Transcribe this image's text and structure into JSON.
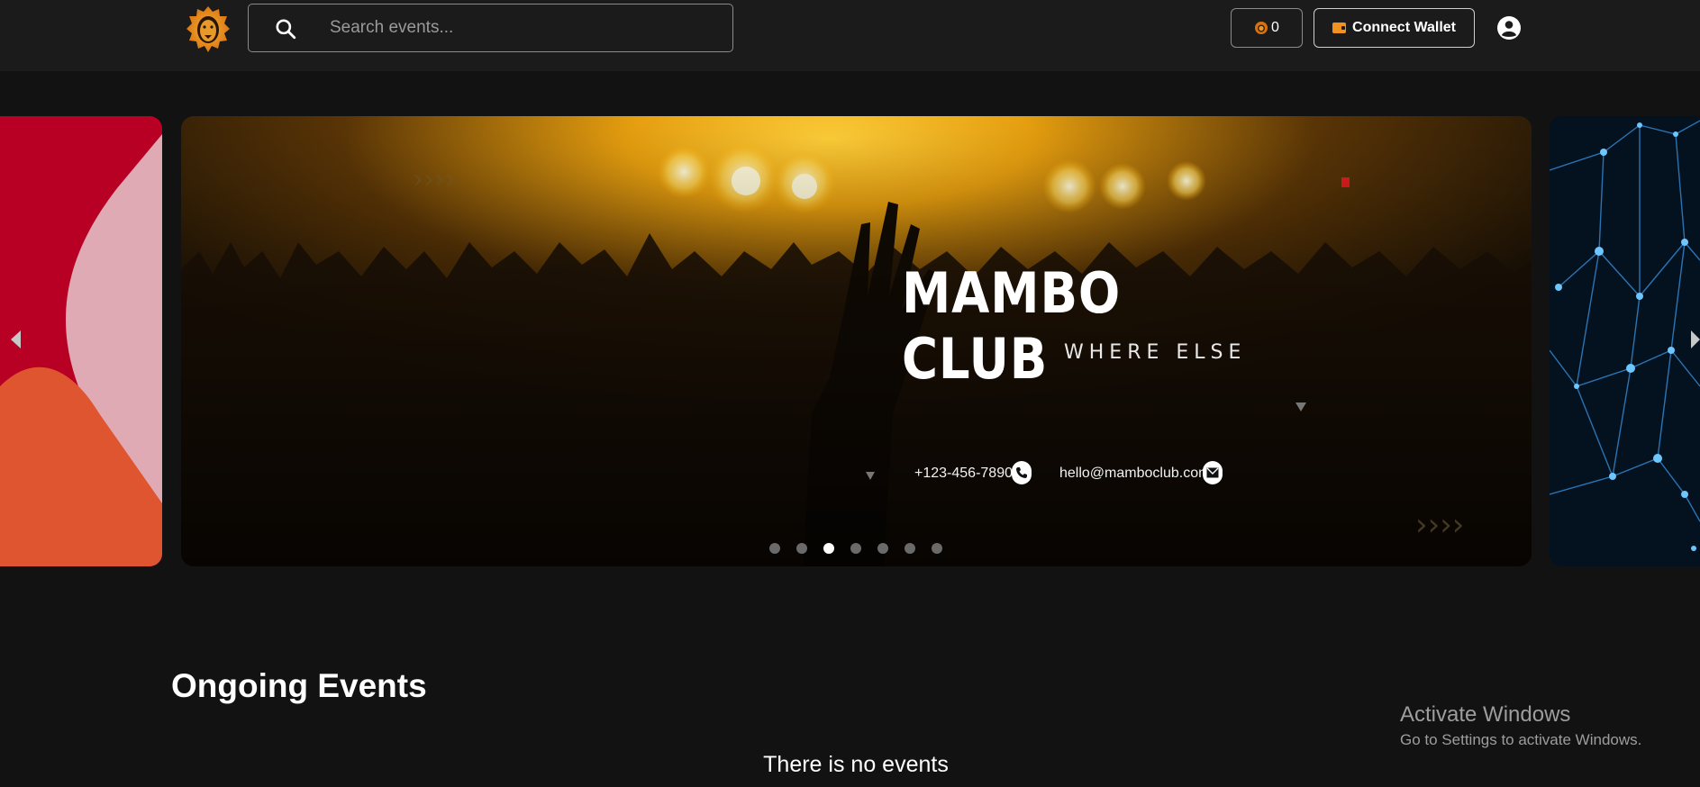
{
  "header": {
    "logo_name": "lion-logo",
    "search": {
      "placeholder": "Search events...",
      "value": ""
    },
    "coin_count": "0",
    "wallet_label": "Connect Wallet"
  },
  "carousel": {
    "banner": {
      "title": "MAMBO CLUB",
      "subtitle": "WHERE ELSE",
      "phone": "+123-456-7890",
      "email": "hello@mamboclub.com"
    },
    "dots_total": 7,
    "active_dot": 3
  },
  "ongoing": {
    "title": "Ongoing Events",
    "empty_message": "There is no events"
  },
  "watermark": {
    "line1": "Activate Windows",
    "line2": "Go to Settings to activate Windows."
  },
  "colors": {
    "accent": "#f0921e",
    "background": "#121212",
    "header": "#1b1b1b"
  }
}
